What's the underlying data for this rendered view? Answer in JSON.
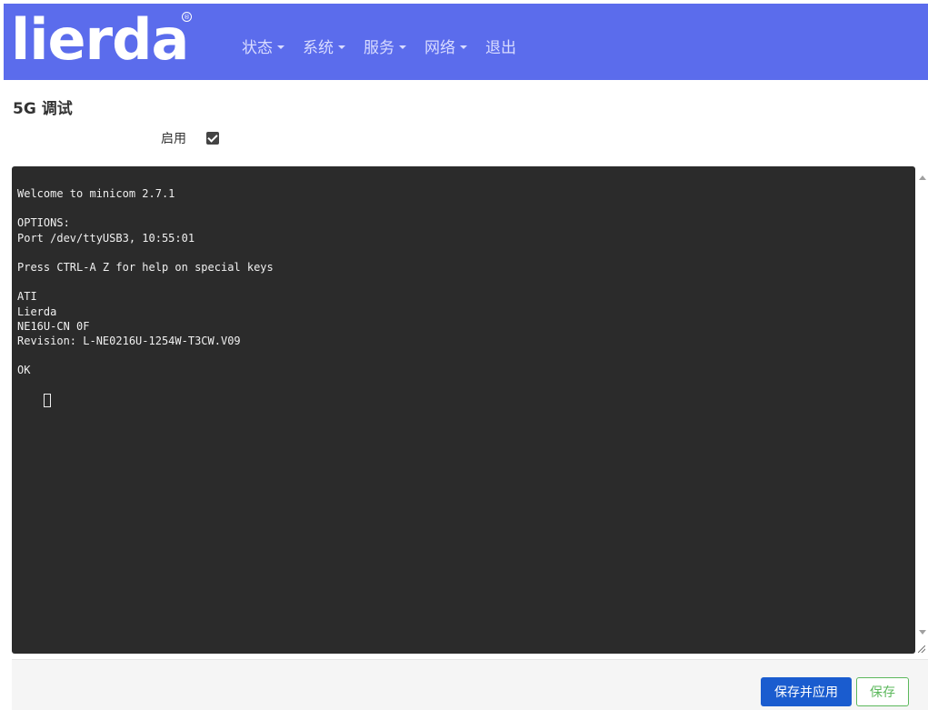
{
  "header": {
    "logo_text": "lierda",
    "logo_reg_mark": "®",
    "nav": [
      {
        "label": "状态",
        "has_dropdown": true
      },
      {
        "label": "系统",
        "has_dropdown": true
      },
      {
        "label": "服务",
        "has_dropdown": true
      },
      {
        "label": "网络",
        "has_dropdown": true
      },
      {
        "label": "退出",
        "has_dropdown": false
      }
    ]
  },
  "page": {
    "title": "5G 调试"
  },
  "enable": {
    "label": "启用",
    "checked": true
  },
  "terminal": {
    "lines": [
      "Welcome to minicom 2.7.1",
      "",
      "OPTIONS:",
      "Port /dev/ttyUSB3, 10:55:01",
      "",
      "Press CTRL-A Z for help on special keys",
      "",
      "ATI",
      "Lierda",
      "NE16U-CN 0F",
      "Revision: L-NE0216U-1254W-T3CW.V09",
      "",
      "OK"
    ]
  },
  "footer": {
    "save_apply_label": "保存并应用",
    "save_label": "保存"
  },
  "colors": {
    "header_bg": "#5b6cec",
    "terminal_bg": "#2b2b2b",
    "primary_button": "#1a5ccf",
    "save_button": "#5cb85c"
  }
}
